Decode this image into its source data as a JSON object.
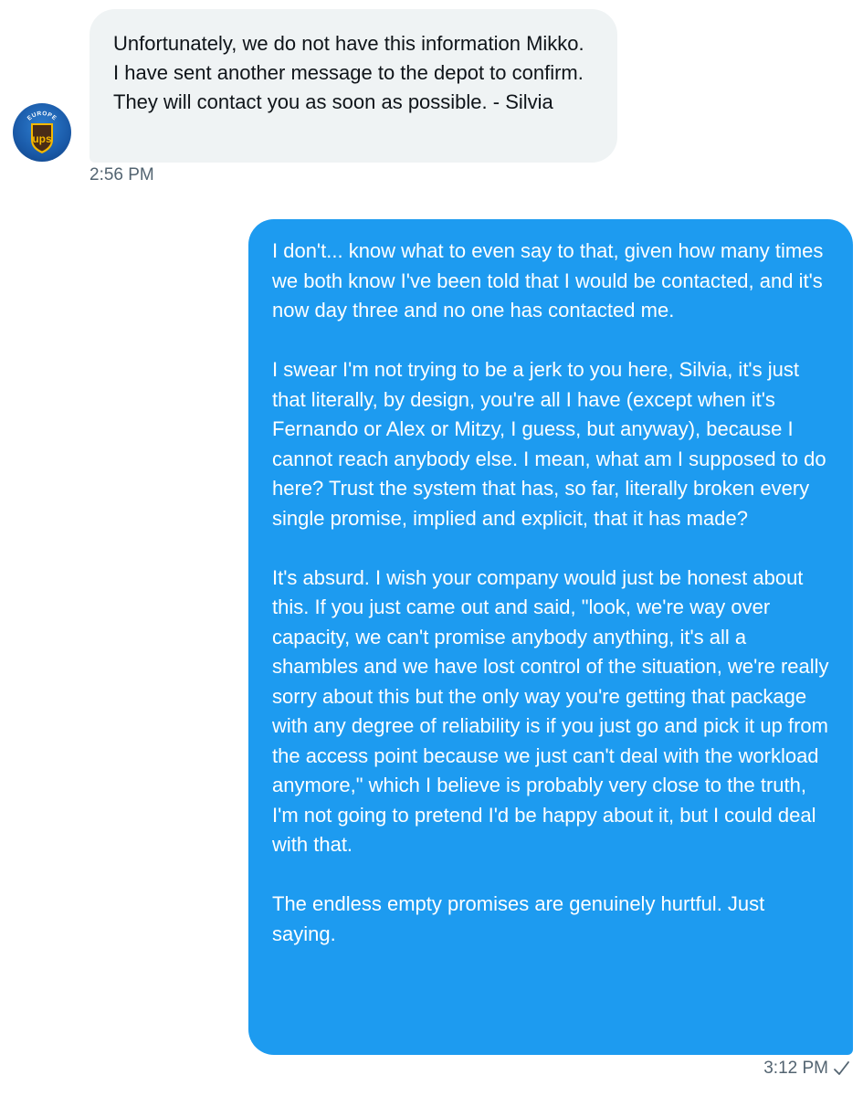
{
  "incoming": {
    "sender_avatar": {
      "icon": "ups-europe-logo-icon",
      "logo_top_text": "EUROPE",
      "logo_text": "ups"
    },
    "text": "Unfortunately, we do not have this information Mikko. I have sent another message to the depot to confirm. They will contact you as soon as possible. - Silvia",
    "time": "2:56 PM"
  },
  "outgoing": {
    "paragraphs": [
      "I don't... know what to even say to that, given how many times we both know I've been told that I would be contacted, and it's now day three and no one has contacted me.",
      "I swear I'm not trying to be a jerk to you here, Silvia, it's just that literally, by design, you're all I have (except when it's Fernando or Alex or Mitzy, I guess, but anyway), because I cannot reach anybody else. I mean, what am I supposed to do here? Trust the system that has, so far, literally broken every single promise, implied and explicit, that it has made?",
      "It's absurd. I wish your company would just be honest about this. If you just came out and said, \"look, we're way over capacity, we can't promise anybody anything, it's all a shambles and we have lost control of the situation, we're really sorry about this but the only way you're getting that package with any degree of reliability is if you just go and pick it up from the access point because we just can't deal with the workload anymore,\" which I believe is probably very close to the truth, I'm not going to pretend I'd be happy about it, but I could deal with that.",
      "The endless empty promises are genuinely hurtful. Just saying."
    ],
    "time": "3:12 PM",
    "status_icon": "check-icon"
  },
  "colors": {
    "outgoing_bubble": "#1d9bf0",
    "incoming_bubble": "#eff3f4",
    "timestamp": "#536471"
  }
}
